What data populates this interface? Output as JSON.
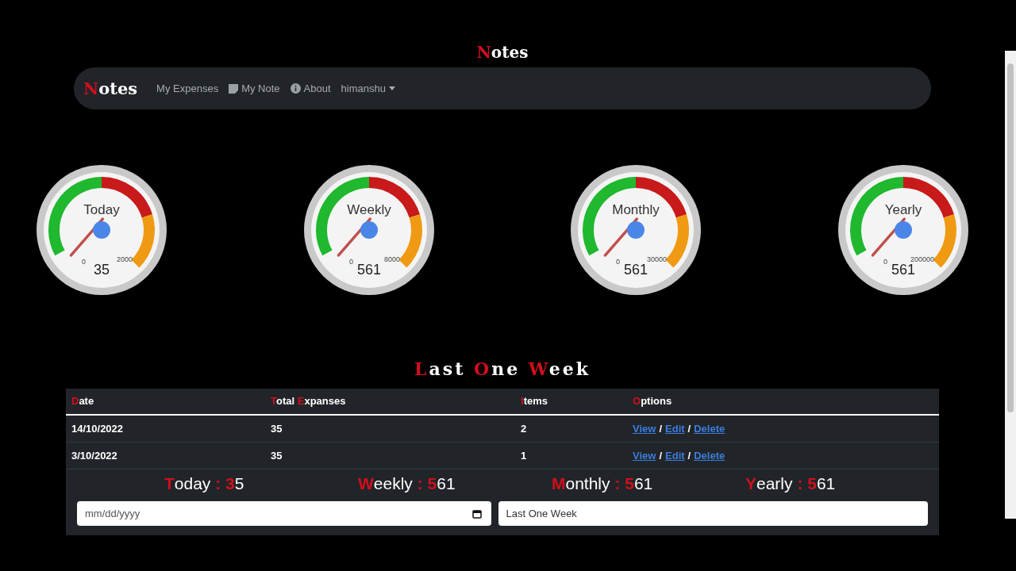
{
  "page_title": "Notes",
  "navbar": {
    "brand": "Notes",
    "items": [
      {
        "label": "My Expenses",
        "kind": "link"
      },
      {
        "label": "My Note",
        "kind": "note"
      },
      {
        "label": "About",
        "kind": "info"
      },
      {
        "label": "himanshu",
        "kind": "dropdown"
      }
    ]
  },
  "gauges": [
    {
      "title": "Today",
      "min": "0",
      "max": "2000",
      "value": "35"
    },
    {
      "title": "Weekly",
      "min": "0",
      "max": "8000",
      "value": "561"
    },
    {
      "title": "Monthly",
      "min": "0",
      "max": "30000",
      "value": "561"
    },
    {
      "title": "Yearly",
      "min": "0",
      "max": "200000",
      "value": "561"
    }
  ],
  "section_title": "Last One Week",
  "table": {
    "columns": [
      "Date",
      "Total Expanses",
      "Items",
      "Options"
    ],
    "rows": [
      {
        "date": "14/10/2022",
        "total": "35",
        "items": "2",
        "options": [
          {
            "kind": "link",
            "label": "View"
          },
          {
            "kind": "separator",
            "label": "/"
          },
          {
            "kind": "link",
            "label": "Edit"
          },
          {
            "kind": "separator",
            "label": "/"
          },
          {
            "kind": "link",
            "label": "Delete"
          }
        ]
      },
      {
        "date": "3/10/2022",
        "total": "35",
        "items": "1",
        "options": [
          {
            "kind": "link",
            "label": "View"
          },
          {
            "kind": "separator",
            "label": "/"
          },
          {
            "kind": "link",
            "label": "Edit"
          },
          {
            "kind": "separator",
            "label": "/"
          },
          {
            "kind": "link",
            "label": "Delete"
          }
        ]
      }
    ]
  },
  "summary": [
    "Today : 35",
    "Weekly : 561",
    "Monthly : 561",
    "Yearly : 561"
  ],
  "filters": {
    "date": {
      "placeholder": "mm/dd/yyyy"
    },
    "range": {
      "value": "Last One Week"
    }
  }
}
